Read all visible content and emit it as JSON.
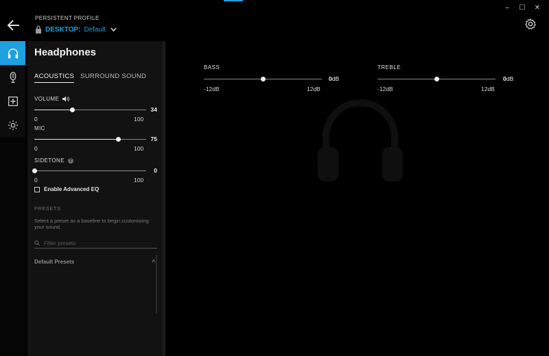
{
  "window": {
    "controls": [
      "–",
      "☐",
      "✕"
    ]
  },
  "header": {
    "profile_label": "PERSISTENT PROFILE",
    "profile_device": "DESKTOP:",
    "profile_name": "Default",
    "accent": "#1fa0e0"
  },
  "rail": {
    "items": [
      {
        "icon": "headphones-icon",
        "active": true
      },
      {
        "icon": "microphone-icon",
        "active": false
      },
      {
        "icon": "add-icon",
        "active": false
      },
      {
        "icon": "lighting-icon",
        "active": false
      }
    ]
  },
  "panel": {
    "title": "Headphones",
    "tabs": [
      {
        "label": "ACOUSTICS",
        "active": true
      },
      {
        "label": "SURROUND SOUND",
        "active": false
      }
    ],
    "volume": {
      "label": "VOLUME",
      "value": "34",
      "min": "0",
      "max": "100",
      "level": 0.34
    },
    "mic": {
      "label": "MIC",
      "value": "75",
      "min": "0",
      "max": "100",
      "level": 0.75
    },
    "sidetone": {
      "label": "SIDETONE",
      "help": "?",
      "value": "0",
      "min": "0",
      "max": "100",
      "level": 0
    },
    "advanced_eq_label": "Enable Advanced EQ",
    "presets_heading": "PRESETS",
    "presets_desc": "Select a preset as a baseline to begin customizing your sound.",
    "filter_placeholder": "Filter presets",
    "default_presets_label": "Default Presets",
    "default_presets_chevron": "^"
  },
  "eq": {
    "bass": {
      "label": "BASS",
      "value": "0",
      "unit": "dB",
      "min": "-12dB",
      "max": "12dB",
      "level": 0.5
    },
    "treble": {
      "label": "TREBLE",
      "value": "0",
      "unit": "dB",
      "min": "-12dB",
      "max": "12dB",
      "level": 0.5
    }
  }
}
